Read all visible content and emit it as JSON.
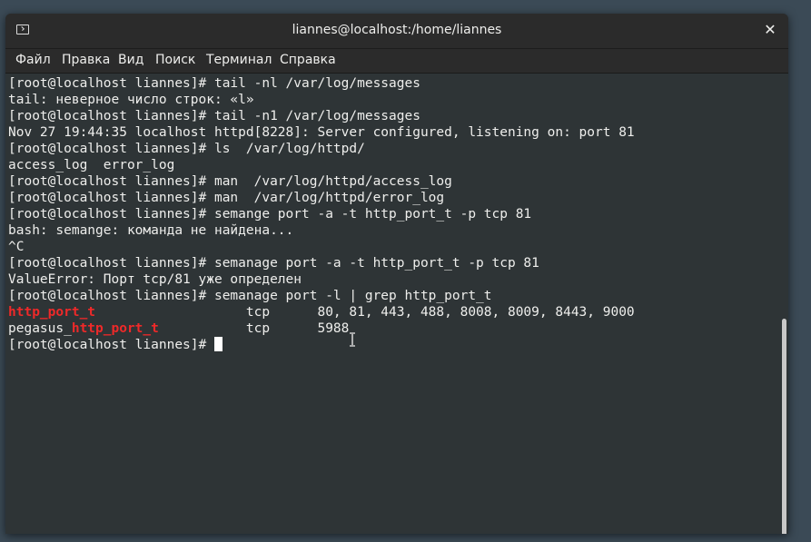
{
  "window": {
    "title": "liannes@localhost:/home/liannes",
    "icons": {
      "terminal": "terminal-icon",
      "close": "close-icon"
    },
    "close_glyph": "✕"
  },
  "menu": {
    "items": [
      "Файл",
      "Правка",
      "Вид",
      "Поиск",
      "Терминал",
      "Справка"
    ]
  },
  "terminal": {
    "lines": [
      "[root@localhost liannes]# tail -nl /var/log/messages",
      "tail: неверное число строк: «l»",
      "[root@localhost liannes]# tail -n1 /var/log/messages",
      "Nov 27 19:44:35 localhost httpd[8228]: Server configured, listening on: port 81",
      "[root@localhost liannes]# ls  /var/log/httpd/",
      "access_log  error_log",
      "[root@localhost liannes]# man  /var/log/httpd/access_log",
      "[root@localhost liannes]# man  /var/log/httpd/error_log",
      "[root@localhost liannes]# semange port -a -t http_port_t -p tcp 81",
      "bash: semange: команда не найдена...",
      "^C",
      "[root@localhost liannes]# semanage port -a -t http_port_t -p tcp 81",
      "ValueError: Порт tcp/81 уже определен",
      "[root@localhost liannes]# semanage port -l | grep http_port_t"
    ],
    "grep_rows": [
      {
        "prefix": "",
        "match": "http_port_t",
        "rest": "                   tcp      80, 81, 443, 488, 8008, 8009, 8443, 9000"
      },
      {
        "prefix": "pegasus_",
        "match": "http_port_t",
        "rest": "           tcp      5988"
      }
    ],
    "prompt": "[root@localhost liannes]# ",
    "match_color": "#ef2929",
    "text_color": "#eeeeec",
    "background_color": "#2e3436"
  }
}
